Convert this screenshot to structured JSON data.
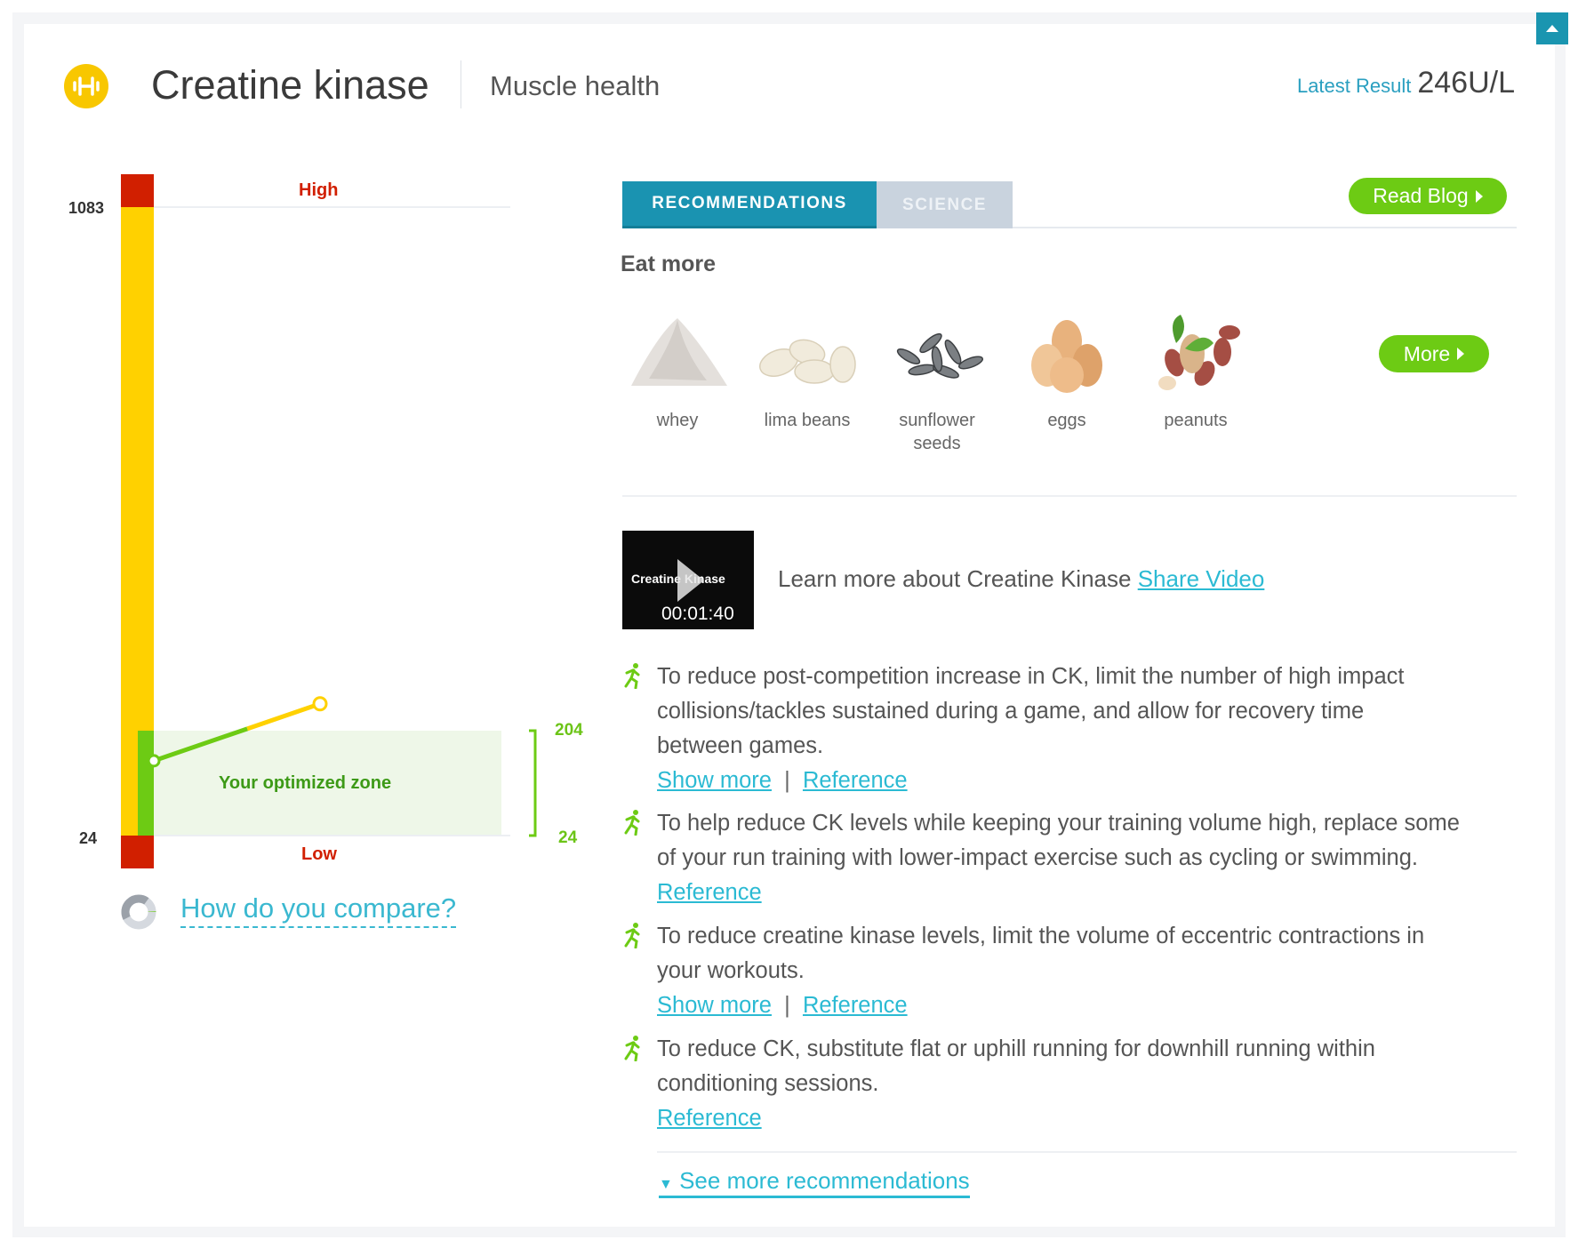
{
  "header": {
    "title": "Creatine kinase",
    "category": "Muscle health",
    "latest_label": "Latest Result",
    "latest_value": "246U/L",
    "logo_color": "#f8c700"
  },
  "range_chart": {
    "high_label": "High",
    "low_label": "Low",
    "high_value": "1083",
    "low_value": "24",
    "zone_label": "Your optimized zone",
    "zone_top": "204",
    "zone_bottom": "24",
    "results": [
      150,
      246
    ],
    "colors": {
      "out_of_range": "#d11f00",
      "normal": "#ffd100",
      "optimized": "#6dcb14"
    }
  },
  "compare": {
    "label": "How do you compare?"
  },
  "tabs": [
    {
      "label": "RECOMMENDATIONS",
      "active": true
    },
    {
      "label": "SCIENCE",
      "active": false
    }
  ],
  "read_blog_label": "Read Blog",
  "eat_more": {
    "heading": "Eat more",
    "foods": [
      {
        "name": "whey",
        "icon": "whey-powder-image"
      },
      {
        "name": "lima beans",
        "icon": "lima-beans-image"
      },
      {
        "name": "sunflower seeds",
        "icon": "sunflower-seeds-image"
      },
      {
        "name": "eggs",
        "icon": "eggs-image"
      },
      {
        "name": "peanuts",
        "icon": "peanuts-image"
      }
    ],
    "more_label": "More"
  },
  "video": {
    "thumb_title": "Creatine Kinase",
    "duration": "00:01:40",
    "text": "Learn more about Creatine Kinase",
    "share_label": "Share Video"
  },
  "recommendations": [
    {
      "lines": [
        "To reduce post-competition increase in CK, limit the number of high impact",
        "collisions/tackles sustained during a game, and allow for recovery time",
        "between games."
      ],
      "show_more": "Show more",
      "reference": "Reference"
    },
    {
      "lines": [
        "To help reduce CK levels while keeping your training volume high, replace some",
        "of your run training with lower-impact exercise such as cycling or swimming."
      ],
      "reference": "Reference"
    },
    {
      "lines": [
        "To reduce creatine kinase levels, limit the volume of eccentric contractions in",
        "your workouts."
      ],
      "show_more": "Show more",
      "reference": "Reference"
    },
    {
      "lines": [
        "To reduce CK, substitute flat or uphill running for downhill running within",
        "conditioning sessions."
      ],
      "reference": "Reference"
    }
  ],
  "link_separator": "|",
  "see_more_label": "See more recommendations"
}
